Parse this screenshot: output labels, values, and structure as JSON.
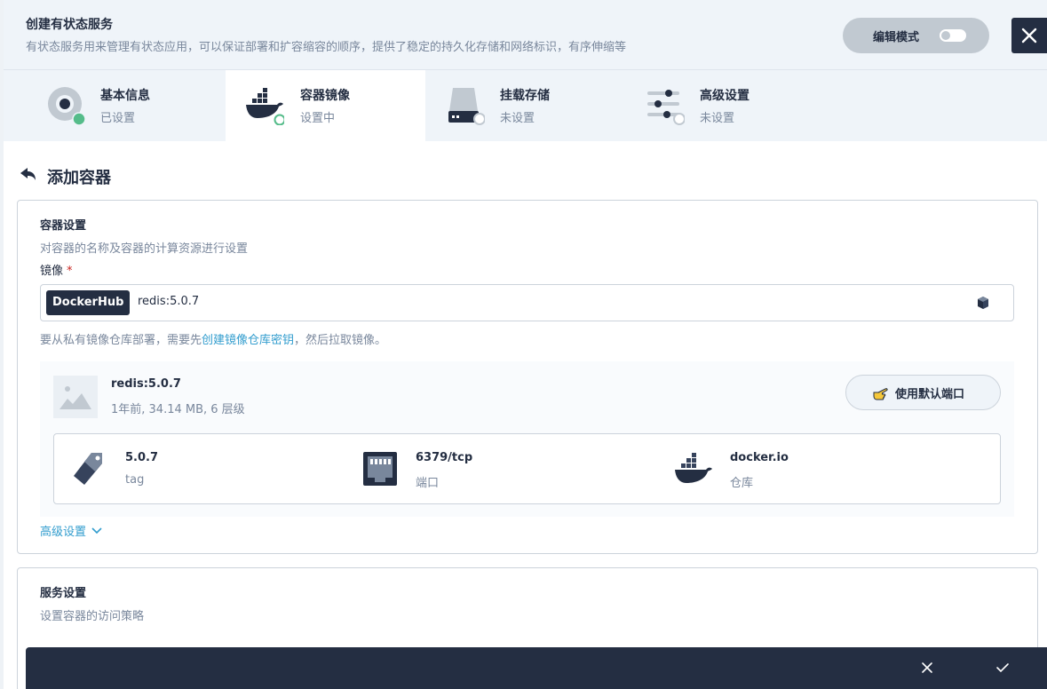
{
  "header": {
    "title": "创建有状态服务",
    "description": "有状态服务用来管理有状态应用，可以保证部署和扩容缩容的顺序，提供了稳定的持久化存储和网络标识，有序伸缩等",
    "edit_mode_label": "编辑模式",
    "close_icon": "close-icon"
  },
  "steps": [
    {
      "title": "基本信息",
      "status": "已设置",
      "icon": "basic-info-icon",
      "indicator_color": "#55bc8a"
    },
    {
      "title": "容器镜像",
      "status": "设置中",
      "icon": "docker-icon",
      "indicator_color": "#55bc8a"
    },
    {
      "title": "挂载存储",
      "status": "未设置",
      "icon": "storage-icon",
      "indicator_color": "#c1c9d1"
    },
    {
      "title": "高级设置",
      "status": "未设置",
      "icon": "sliders-icon",
      "indicator_color": "#c1c9d1"
    }
  ],
  "section": {
    "title": "添加容器"
  },
  "container_settings": {
    "title": "容器设置",
    "description": "对容器的名称及容器的计算资源进行设置",
    "image_label": "镜像",
    "required_mark": "*",
    "registry": "DockerHub",
    "image_value": "redis:5.0.7",
    "hint_prefix": "要从私有镜像仓库部署，需要先",
    "hint_link": "创建镜像仓库密钥",
    "hint_suffix": "，然后拉取镜像。",
    "image_name": "redis:5.0.7",
    "image_meta": "1年前, 34.14 MB, 6 层级",
    "default_port_button": "使用默认端口",
    "info": [
      {
        "value": "5.0.7",
        "label": "tag",
        "icon": "tag-icon"
      },
      {
        "value": "6379/tcp",
        "label": "端口",
        "icon": "port-icon"
      },
      {
        "value": "docker.io",
        "label": "仓库",
        "icon": "docker-icon"
      }
    ],
    "advanced_label": "高级设置"
  },
  "service_settings": {
    "title": "服务设置",
    "description": "设置容器的访问策略"
  },
  "colors": {
    "dark": "#242e42",
    "link": "#329dce",
    "success": "#55bc8a",
    "muted": "#79879c"
  }
}
